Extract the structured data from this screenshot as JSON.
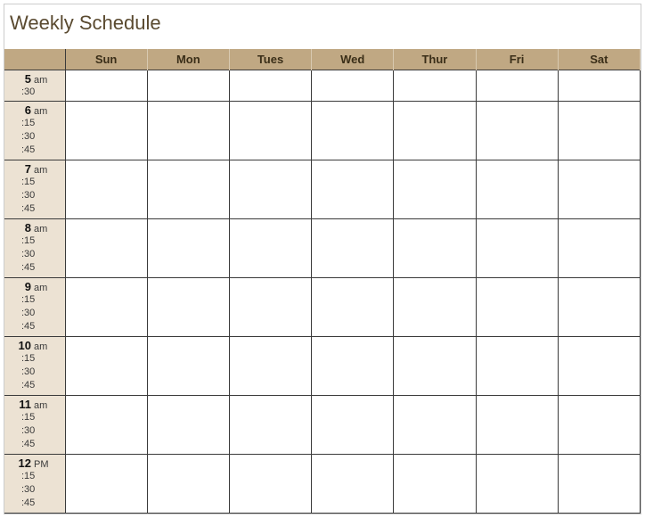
{
  "title": "Weekly Schedule",
  "days": [
    "Sun",
    "Mon",
    "Tues",
    "Wed",
    "Thur",
    "Fri",
    "Sat"
  ],
  "rows": [
    {
      "hour": "5",
      "suffix": "am",
      "subs": [
        ":30"
      ]
    },
    {
      "hour": "6",
      "suffix": "am",
      "subs": [
        ":15",
        ":30",
        ":45"
      ]
    },
    {
      "hour": "7",
      "suffix": "am",
      "subs": [
        ":15",
        ":30",
        ":45"
      ]
    },
    {
      "hour": "8",
      "suffix": "am",
      "subs": [
        ":15",
        ":30",
        ":45"
      ]
    },
    {
      "hour": "9",
      "suffix": "am",
      "subs": [
        ":15",
        ":30",
        ":45"
      ]
    },
    {
      "hour": "10",
      "suffix": "am",
      "subs": [
        ":15",
        ":30",
        ":45"
      ]
    },
    {
      "hour": "11",
      "suffix": "am",
      "subs": [
        ":15",
        ":30",
        ":45"
      ]
    },
    {
      "hour": "12",
      "suffix": "PM",
      "subs": [
        ":15",
        ":30",
        ":45"
      ]
    }
  ]
}
